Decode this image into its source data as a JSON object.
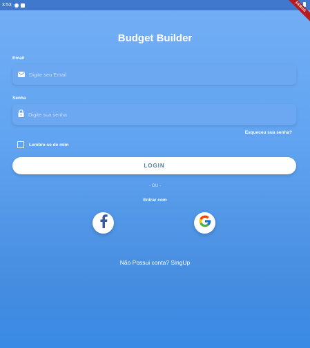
{
  "status_bar": {
    "time": "3:53"
  },
  "debug_banner": "DEBUG",
  "app": {
    "title": "Budget Builder"
  },
  "email": {
    "label": "Email",
    "placeholder": "Digite seu Email",
    "icon": "mail-icon"
  },
  "password": {
    "label": "Senha",
    "placeholder": "Digite sua senha",
    "icon": "lock-icon"
  },
  "forgot_password": "Esqueceu sua senha?",
  "remember_me": {
    "label": "Lembre-se de mim",
    "checked": false
  },
  "login_button": "LOGIN",
  "divider_text": "- OU -",
  "social": {
    "title": "Entrar com",
    "buttons": [
      {
        "name": "facebook",
        "icon": "facebook-icon"
      },
      {
        "name": "google",
        "icon": "google-icon"
      }
    ]
  },
  "signup_link": "Não Possui conta? SingUp",
  "colors": {
    "gradient": [
      "#73aef5",
      "#61a4f1",
      "#478de0",
      "#398ae5"
    ],
    "field_bg": "#6ca8f1",
    "login_text": "#527daa",
    "facebook_blue": "#3b5998"
  }
}
